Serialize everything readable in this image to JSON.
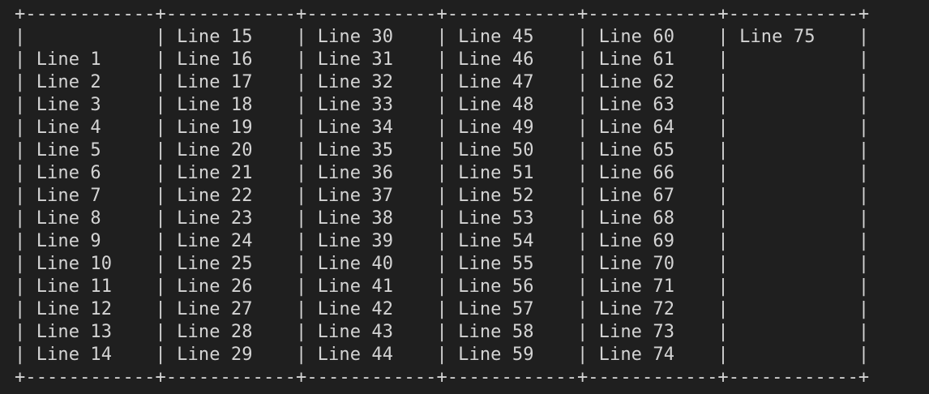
{
  "terminal": {
    "lines": [
      "+------------+------------+------------+------------+------------+------------+",
      "|            | Line 15    | Line 30    | Line 45    | Line 60    | Line 75    |",
      "| Line 1     | Line 16    | Line 31    | Line 46    | Line 61    |            |",
      "| Line 2     | Line 17    | Line 32    | Line 47    | Line 62    |            |",
      "| Line 3     | Line 18    | Line 33    | Line 48    | Line 63    |            |",
      "| Line 4     | Line 19    | Line 34    | Line 49    | Line 64    |            |",
      "| Line 5     | Line 20    | Line 35    | Line 50    | Line 65    |            |",
      "| Line 6     | Line 21    | Line 36    | Line 51    | Line 66    |            |",
      "| Line 7     | Line 22    | Line 37    | Line 52    | Line 67    |            |",
      "| Line 8     | Line 23    | Line 38    | Line 53    | Line 68    |            |",
      "| Line 9     | Line 24    | Line 39    | Line 54    | Line 69    |            |",
      "| Line 10    | Line 25    | Line 40    | Line 55    | Line 70    |            |",
      "| Line 11    | Line 26    | Line 41    | Line 56    | Line 71    |            |",
      "| Line 12    | Line 27    | Line 42    | Line 57    | Line 72    |            |",
      "| Line 13    | Line 28    | Line 43    | Line 58    | Line 73    |            |",
      "| Line 14    | Line 29    | Line 44    | Line 59    | Line 74    |            |",
      "+------------+------------+------------+------------+------------+------------+"
    ]
  },
  "colors": {
    "background": "#1f1f1f",
    "text": "#d4d4d4"
  }
}
